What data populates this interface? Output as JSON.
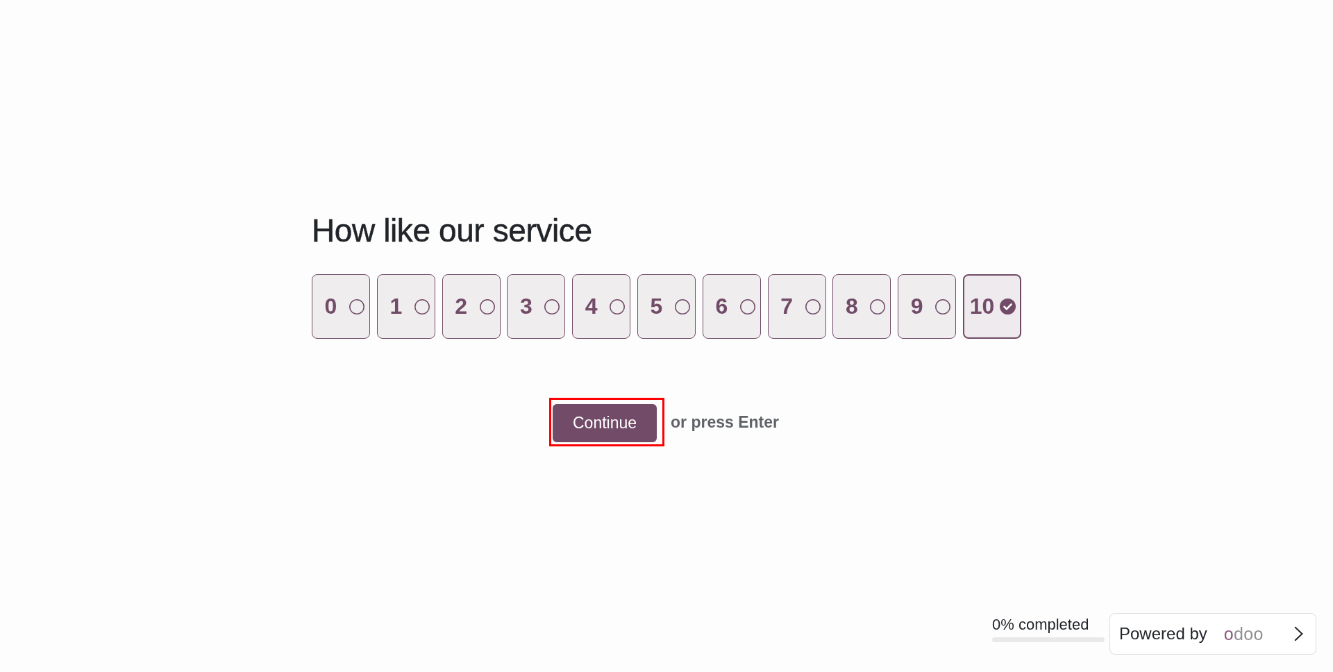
{
  "question": {
    "title": "How like our service"
  },
  "scale": {
    "options": [
      {
        "label": "0",
        "selected": false
      },
      {
        "label": "1",
        "selected": false
      },
      {
        "label": "2",
        "selected": false
      },
      {
        "label": "3",
        "selected": false
      },
      {
        "label": "4",
        "selected": false
      },
      {
        "label": "5",
        "selected": false
      },
      {
        "label": "6",
        "selected": false
      },
      {
        "label": "7",
        "selected": false
      },
      {
        "label": "8",
        "selected": false
      },
      {
        "label": "9",
        "selected": false
      },
      {
        "label": "10",
        "selected": true
      }
    ]
  },
  "continue_button": {
    "label": "Continue",
    "highlighted": true
  },
  "hint": "or press Enter",
  "progress": {
    "label": "0% completed",
    "level": 0
  },
  "powered_by": {
    "label": "Powered by",
    "logo": "odoo"
  }
}
